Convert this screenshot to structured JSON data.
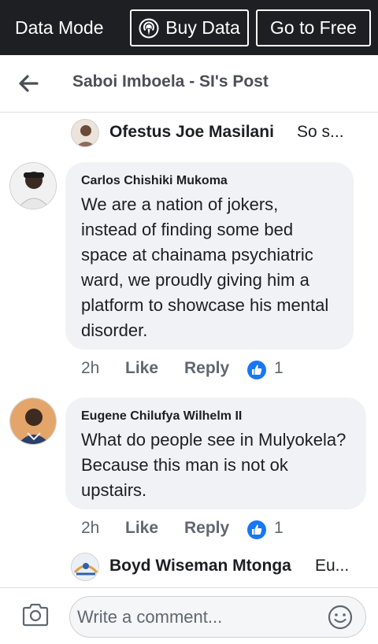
{
  "topbar": {
    "mode_label": "Data Mode",
    "buy_data_label": "Buy Data",
    "go_free_label": "Go to Free",
    "background": "#1d1f23"
  },
  "header": {
    "title": "Saboi Imboela - SI's Post",
    "back_icon": "arrow-left-icon"
  },
  "reply_previews": [
    {
      "name": "Ofestus Joe Masilani",
      "snippet": "So s..."
    },
    {
      "name": "Boyd Wiseman Mtonga",
      "snippet": "Eu..."
    }
  ],
  "comments": [
    {
      "author": "Carlos Chishiki Mukoma",
      "text": "We are a nation of jokers, instead of finding some bed space at chainama psychiatric ward, we proudly giving him a platform to showcase his mental disorder.",
      "time": "2h",
      "like_label": "Like",
      "reply_label": "Reply",
      "reaction_count": "1"
    },
    {
      "author": "Eugene Chilufya Wilhelm II",
      "text": "What do people see in Mulyokela? Because this man is not ok upstairs.",
      "time": "2h",
      "like_label": "Like",
      "reply_label": "Reply",
      "reaction_count": "1"
    }
  ],
  "composer": {
    "placeholder": "Write a comment...",
    "camera_icon": "camera-icon",
    "emoji_icon": "emoji-icon"
  },
  "colors": {
    "bubble": "#f0f2f5",
    "like_blue": "#1877f2",
    "meta_gray": "#606770"
  }
}
